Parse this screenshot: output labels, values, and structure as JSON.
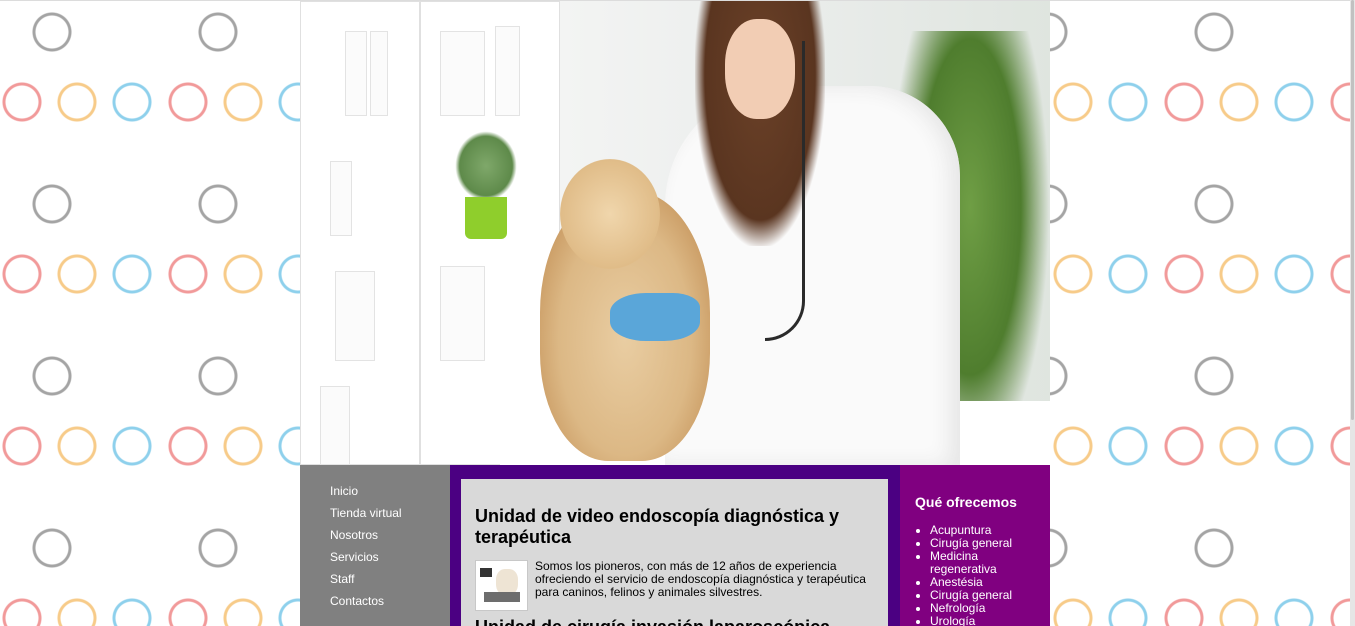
{
  "nav": {
    "items": [
      "Inicio",
      "Tienda virtual",
      "Nosotros",
      "Servicios",
      "Staff",
      "Contactos"
    ]
  },
  "main": {
    "article1": {
      "title": "Unidad de video endoscopía diagnóstica y terapéutica",
      "text": "Somos los pioneros, con más de 12 años de experiencia ofreciendo el servicio de endoscopía diagnóstica y terapéutica para caninos, felinos y animales silvestres."
    },
    "article2": {
      "title": "Unidad de cirugía invasión laparoscópica"
    }
  },
  "aside": {
    "title": "Qué ofrecemos",
    "items": [
      "Acupuntura",
      "Cirugía general",
      "Medicina regenerativa",
      "Anestésia",
      "Cirugía general",
      "Nefrología",
      "Urología"
    ]
  },
  "colors": {
    "nav_bg": "#808080",
    "main_bg": "#4b0082",
    "aside_bg": "#800080",
    "article_bg": "#d9d9d9"
  }
}
